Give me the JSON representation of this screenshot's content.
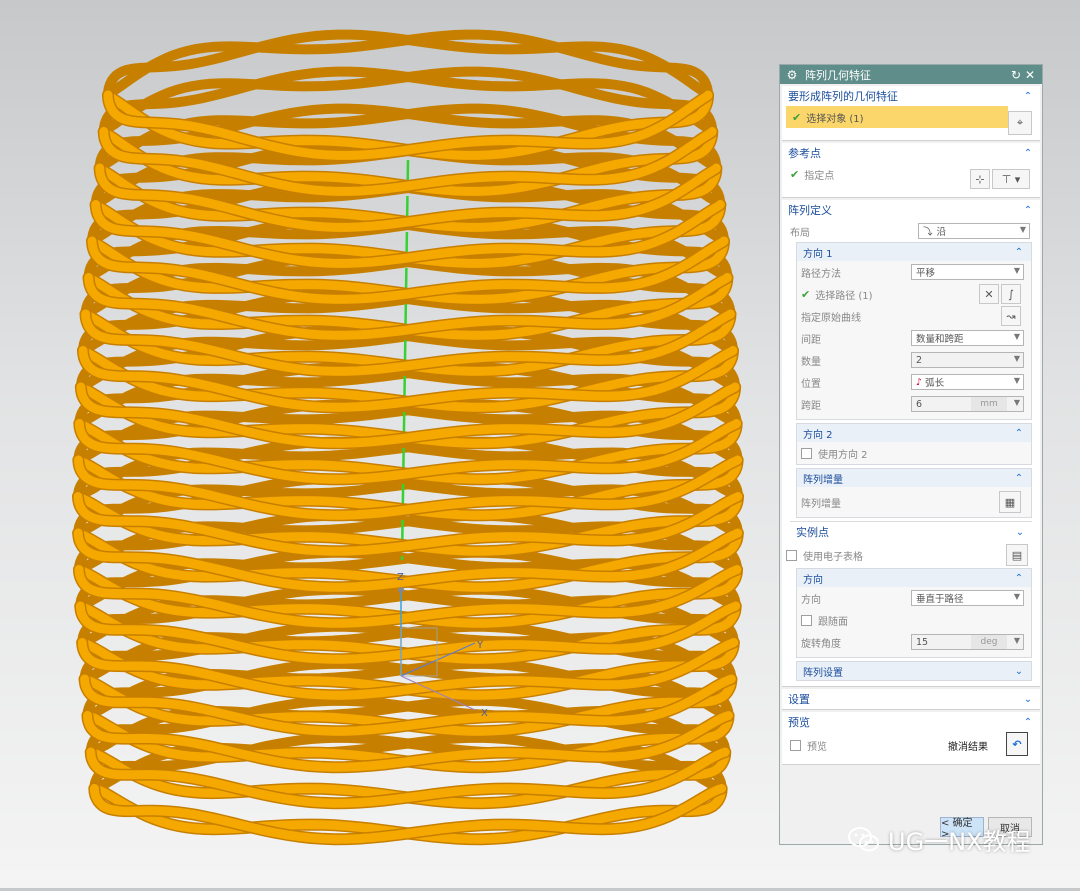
{
  "dialog": {
    "title": "阵列几何特征",
    "sections": {
      "geometry": {
        "title": "要形成阵列的几何特征",
        "select_label": "选择对象 (1)"
      },
      "reference": {
        "title": "参考点",
        "point_label": "指定点"
      },
      "definition": {
        "title": "阵列定义",
        "layout_label": "布局",
        "layout_value": "沿",
        "dir1": {
          "title": "方向 1",
          "path_method_label": "路径方法",
          "path_method_value": "平移",
          "select_path_label": "选择路径 (1)",
          "origin_curve_label": "指定原始曲线",
          "spacing_label": "间距",
          "spacing_value": "数量和跨距",
          "count_label": "数量",
          "count_value": "2",
          "position_label": "位置",
          "position_value": "弧长",
          "span_label": "跨距",
          "span_value": "6",
          "span_unit": "mm"
        },
        "dir2": {
          "title": "方向 2",
          "use_label": "使用方向 2"
        },
        "increment": {
          "title": "阵列增量",
          "label": "阵列增量"
        },
        "instance": {
          "title": "实例点",
          "spreadsheet_label": "使用电子表格"
        },
        "orientation": {
          "title": "方向",
          "direction_label": "方向",
          "direction_value": "垂直于路径",
          "follow_label": "跟随面",
          "rotation_label": "旋转角度",
          "rotation_value": "15",
          "rotation_unit": "deg"
        },
        "settings_sub": {
          "title": "阵列设置"
        }
      },
      "settings": {
        "title": "设置"
      },
      "preview": {
        "title": "预览",
        "preview_label": "预览",
        "undo_label": "撤消结果"
      }
    },
    "buttons": {
      "ok": "< 确定 >",
      "cancel": "取消"
    }
  },
  "viewport": {
    "axis_labels": {
      "x": "X",
      "y": "Y",
      "z": "Z"
    },
    "colors": {
      "coil": "#f5a800",
      "coil_dark": "#c77f00",
      "path_line": "#35d135"
    }
  },
  "watermark": {
    "text": "UG一NX教程"
  }
}
